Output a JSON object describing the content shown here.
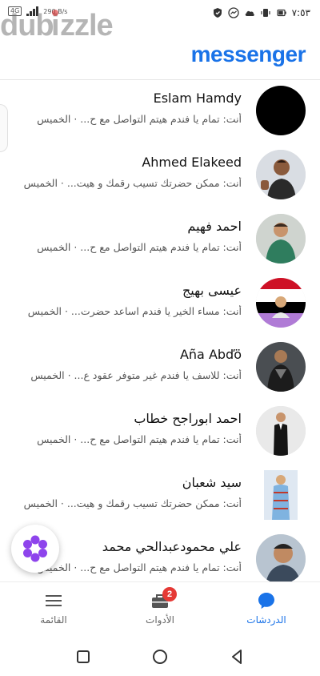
{
  "status_bar": {
    "network": "4G",
    "speed": "290 B/s",
    "time": "٧:٥٣"
  },
  "watermark": {
    "text_main": "dubizzle"
  },
  "header": {
    "logo": "messenger"
  },
  "chats": [
    {
      "name": "Eslam Hamdy",
      "preview": "أنت: تمام يا فندم هيتم التواصل مع ح... · الخميس",
      "avatar": "black"
    },
    {
      "name": "Ahmed Elakeed",
      "preview": "أنت: ممكن حضرتك تسيب رقمك و هيت... · الخميس",
      "avatar": "man-thumbs-up"
    },
    {
      "name": "احمد فهيم",
      "preview": "أنت: تمام يا فندم هيتم التواصل مع ح... · الخميس",
      "avatar": "man-green-shirt"
    },
    {
      "name": "عيسى بهيج",
      "preview": "أنت: مساء الخير يا فندم  اساعد حضرت... · الخميس",
      "avatar": "flag-photo"
    },
    {
      "name": "Aña Abďö",
      "preview": "أنت: للاسف يا فندم غير متوفر عقود ع... · الخميس",
      "avatar": "man-dark-suit"
    },
    {
      "name": "احمد ابوراجح خطاب",
      "preview": "أنت: تمام يا فندم هيتم التواصل مع ح... · الخميس",
      "avatar": "man-tuxedo"
    },
    {
      "name": "سيد شعبان",
      "preview": "أنت: ممكن حضرتك تسيب رقمك و هيت... · الخميس",
      "avatar": "woman-dress"
    },
    {
      "name": "علي محمودعبدالحي محمد",
      "preview": "أنت: تمام يا فندم هيتم التواصل مع ح... · الخميس",
      "avatar": "man-selfie"
    }
  ],
  "bottom_nav": {
    "chats_label": "الدردشات",
    "tools_label": "الأدوات",
    "tools_badge": "2",
    "menu_label": "القائمة"
  },
  "colors": {
    "accent": "#1a73e8",
    "badge": "#e53935",
    "fab_petals": "#8e44ec"
  }
}
